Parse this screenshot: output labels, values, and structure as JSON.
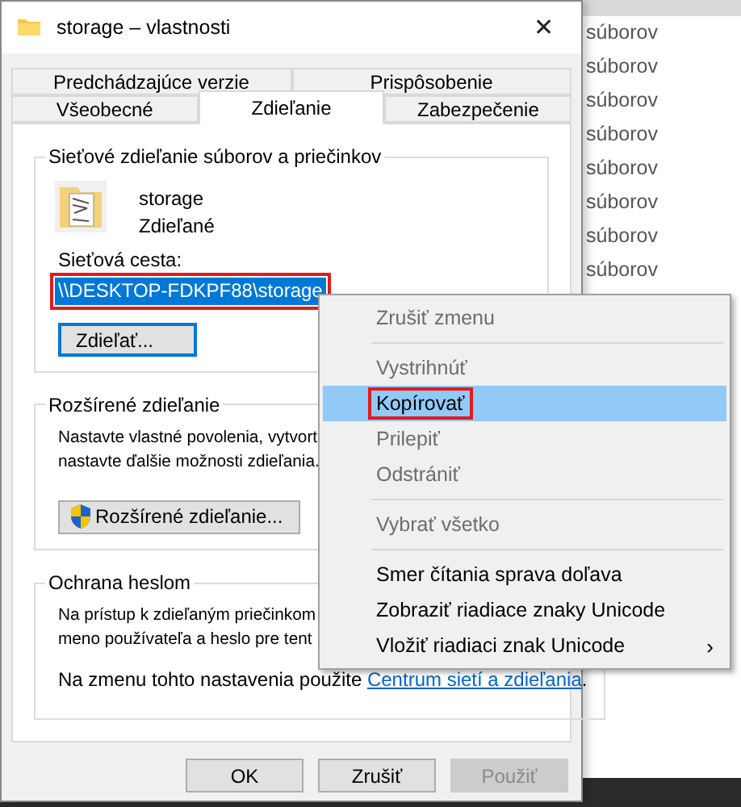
{
  "window": {
    "title": "storage – vlastnosti",
    "close": "✕"
  },
  "tab_rows": [
    [
      {
        "label": "Predchádzajúce verzie",
        "selected": false
      },
      {
        "label": "Prispôsobenie",
        "selected": false
      }
    ],
    [
      {
        "label": "Všeobecné",
        "selected": false
      },
      {
        "label": "Zdieľanie",
        "selected": true
      },
      {
        "label": "Zabezpečenie",
        "selected": false
      }
    ]
  ],
  "network_sharing": {
    "legend": "Sieťové zdieľanie súborov a priečinkov",
    "name": "storage",
    "status": "Zdieľané",
    "path_label": "Sieťová cesta:",
    "path": "\\\\DESKTOP-FDKPF88\\storage",
    "path_selected": true,
    "path_annotated": true,
    "share_button": "Zdieľať..."
  },
  "advanced_sharing": {
    "legend": "Rozšírené zdieľanie",
    "lines": [
      "Nastavte vlastné povolenia, vytvort",
      "nastavte ďalšie možnosti zdieľania."
    ],
    "button": "Rozšírené zdieľanie..."
  },
  "password_protection": {
    "legend": "Ochrana heslom",
    "lines": [
      "Na prístup k zdieľaným priečinkom",
      "meno používateľa a heslo pre tent"
    ],
    "note": "Na zmenu tohto nastavenia použite ",
    "link": "Centrum sietí a zdieľania",
    "note_end": "."
  },
  "buttons": [
    {
      "label": "OK",
      "disabled": false
    },
    {
      "label": "Zrušiť",
      "disabled": false
    },
    {
      "label": "Použiť",
      "disabled": true
    }
  ],
  "context_menu": [
    {
      "kind": "item",
      "label": "Zrušiť zmenu",
      "disabled": true,
      "selected": false,
      "annotated": false
    },
    {
      "kind": "separator"
    },
    {
      "kind": "item",
      "label": "Vystrihnúť",
      "disabled": true,
      "selected": false,
      "annotated": false
    },
    {
      "kind": "item",
      "label": "Kopírovať",
      "disabled": false,
      "selected": true,
      "annotated": true
    },
    {
      "kind": "item",
      "label": "Prilepiť",
      "disabled": true,
      "selected": false,
      "annotated": false
    },
    {
      "kind": "item",
      "label": "Odstrániť",
      "disabled": true,
      "selected": false,
      "annotated": false
    },
    {
      "kind": "separator"
    },
    {
      "kind": "item",
      "label": "Vybrať všetko",
      "disabled": true,
      "selected": false,
      "annotated": false
    },
    {
      "kind": "separator"
    },
    {
      "kind": "item",
      "label": "Smer čítania sprava doľava",
      "disabled": false,
      "selected": false,
      "annotated": false
    },
    {
      "kind": "item",
      "label": "Zobraziť riadiace znaky Unicode",
      "disabled": false,
      "selected": false,
      "annotated": false
    },
    {
      "kind": "submenu",
      "label": "Vložiť riadiaci znak Unicode",
      "arrow": "›",
      "disabled": false,
      "selected": false,
      "annotated": false
    }
  ],
  "background_list": [
    {
      "label": "súborov",
      "selected": false
    },
    {
      "label": "súborov",
      "selected": false
    },
    {
      "label": "súborov",
      "selected": false
    },
    {
      "label": "súborov",
      "selected": false
    },
    {
      "label": "súborov",
      "selected": false
    },
    {
      "label": "súborov",
      "selected": false
    },
    {
      "label": "súborov",
      "selected": false
    },
    {
      "label": "súborov",
      "selected": false
    }
  ]
}
